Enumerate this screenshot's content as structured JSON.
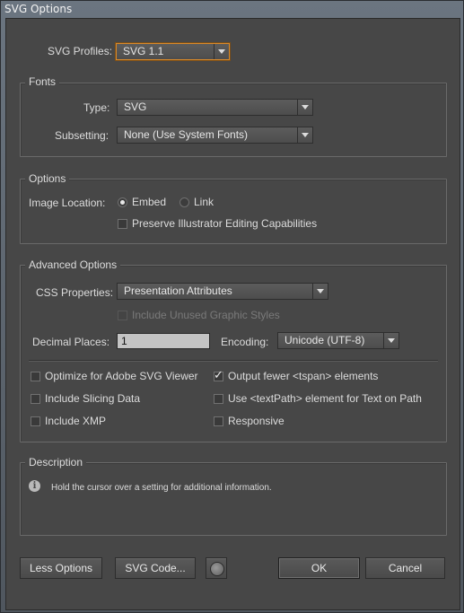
{
  "window": {
    "title": "SVG Options"
  },
  "svg_profiles": {
    "label": "SVG Profiles:",
    "value": "SVG 1.1"
  },
  "fonts": {
    "title": "Fonts",
    "type_label": "Type:",
    "type_value": "SVG",
    "subsetting_label": "Subsetting:",
    "subsetting_value": "None (Use System Fonts)"
  },
  "options": {
    "title": "Options",
    "image_location_label": "Image Location:",
    "embed_label": "Embed",
    "embed_selected": true,
    "link_label": "Link",
    "preserve_label": "Preserve Illustrator Editing Capabilities",
    "preserve_checked": false
  },
  "advanced": {
    "title": "Advanced Options",
    "css_label": "CSS Properties:",
    "css_value": "Presentation Attributes",
    "unused_styles_label": "Include Unused Graphic Styles",
    "decimal_label": "Decimal Places:",
    "decimal_value": "1",
    "encoding_label": "Encoding:",
    "encoding_value": "Unicode (UTF-8)",
    "checkboxes": [
      {
        "label": "Optimize for Adobe SVG Viewer",
        "checked": false
      },
      {
        "label": "Output fewer <tspan> elements",
        "checked": true
      },
      {
        "label": "Include Slicing Data",
        "checked": false
      },
      {
        "label": "Use <textPath> element for Text on Path",
        "checked": false
      },
      {
        "label": "Include XMP",
        "checked": false
      },
      {
        "label": "Responsive",
        "checked": false
      }
    ]
  },
  "description": {
    "title": "Description",
    "icon": "info-icon",
    "text": "Hold the cursor over a setting for additional information."
  },
  "buttons": {
    "less_options": "Less Options",
    "svg_code": "SVG Code...",
    "ok": "OK",
    "cancel": "Cancel",
    "globe_icon": "globe-icon"
  },
  "colors": {
    "dialog_bg": "#474747",
    "focus_accent": "#d98a2a"
  }
}
